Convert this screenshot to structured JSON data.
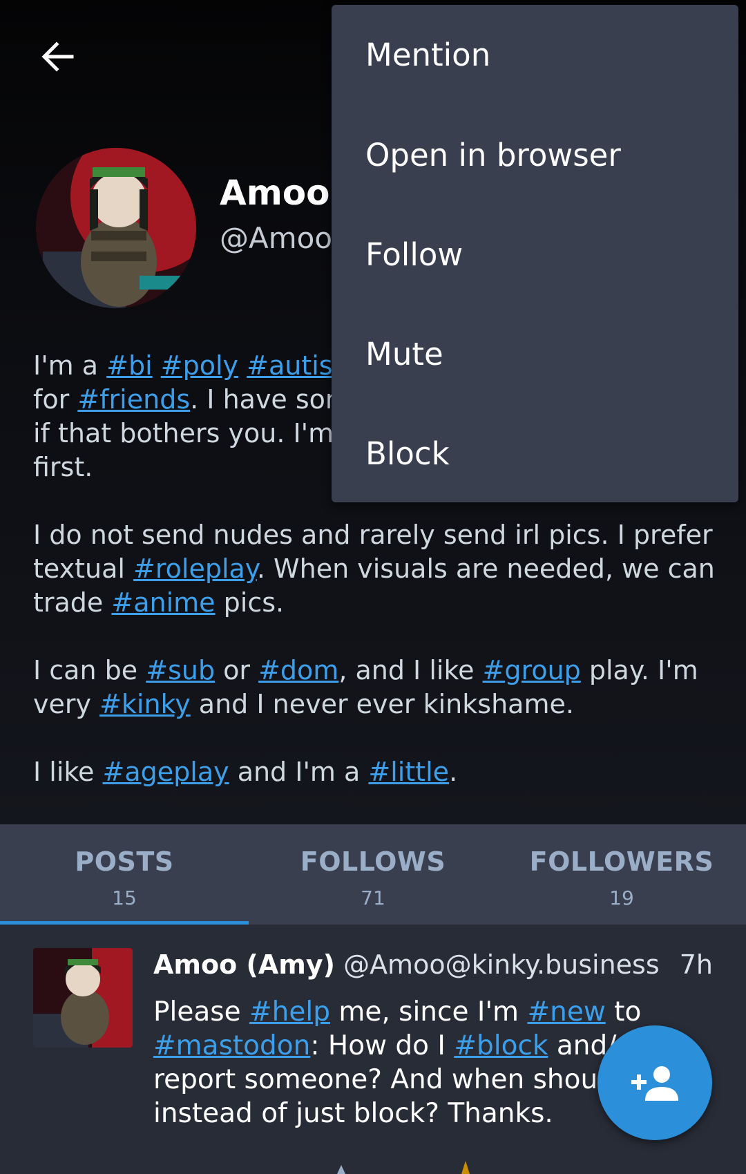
{
  "profile": {
    "display_name": "Amoo (",
    "handle": "@Amoo(",
    "bio": {
      "p1": {
        "t1": "I'm a ",
        "tag_bi": "#bi",
        "tag_poly": "#poly",
        "tag_autistic": "#autistic",
        "t2": "for ",
        "tag_friends": "#friends",
        "t3": ". I have som",
        "t4": "if that bothers you. I'm ",
        "tag_hidden": "#",
        "t5": "first."
      },
      "p2": {
        "t1": "I do not send nudes and rarely send irl pics. I prefer textual ",
        "tag_roleplay": "#roleplay",
        "t2": ". When visuals are needed, we can trade ",
        "tag_anime": "#anime",
        "t3": " pics."
      },
      "p3": {
        "t1": "I can be ",
        "tag_sub": "#sub",
        "t2": " or ",
        "tag_dom": "#dom",
        "t3": ", and I like ",
        "tag_group": "#group",
        "t4": " play. I'm very ",
        "tag_kinky": "#kinky",
        "t5": " and I never ever kinkshame."
      },
      "p4": {
        "t1": "I like ",
        "tag_ageplay": "#ageplay",
        "t2": " and I'm a ",
        "tag_little": "#little",
        "t3": "."
      }
    }
  },
  "tabs": [
    {
      "label": "POSTS",
      "count": "15"
    },
    {
      "label": "FOLLOWS",
      "count": "71"
    },
    {
      "label": "FOLLOWERS",
      "count": "19"
    }
  ],
  "post": {
    "name": "Amoo (Amy)",
    "handle": "@Amoo@kinky.business",
    "time": "7h",
    "body": {
      "t1": "Please ",
      "tag_help": "#help",
      "t2": " me, since I'm ",
      "tag_new": "#new",
      "t3": " to",
      "tag_mastodon": "#mastodon",
      "t4": ": How do I ",
      "tag_block": "#block",
      "t5": " and/or",
      "t6": "report someone? And when should",
      "t7": "instead of just block? Thanks."
    }
  },
  "menu": {
    "items": [
      "Mention",
      "Open in browser",
      "Follow",
      "Mute",
      "Block"
    ]
  },
  "icons": {
    "back": "arrow-left-icon",
    "fab": "person-add-icon"
  },
  "colors": {
    "accent": "#2b90d9",
    "link": "#3d9fe9",
    "menu_bg": "#393f4f",
    "post_bg": "#282c37"
  }
}
